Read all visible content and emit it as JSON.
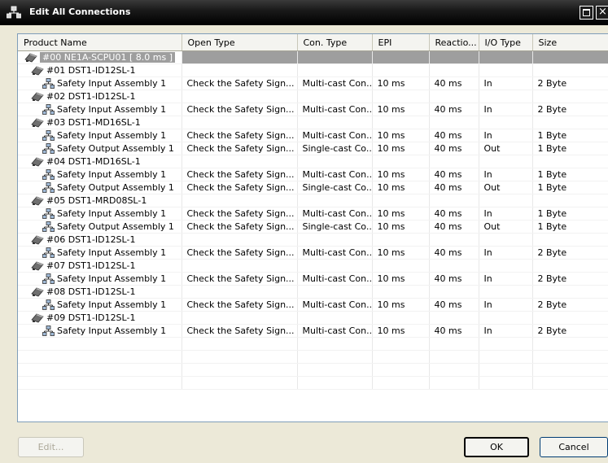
{
  "window": {
    "title": "Edit All Connections"
  },
  "columns": [
    "Product Name",
    "Open Type",
    "Con. Type",
    "EPI",
    "Reactio...",
    "I/O Type",
    "Size"
  ],
  "rows": [
    {
      "level": 0,
      "icon": "device",
      "cells": [
        "#00 NE1A-SCPU01 [ 8.0 ms ]",
        "",
        "",
        "",
        "",
        "",
        ""
      ]
    },
    {
      "level": 1,
      "icon": "device",
      "cells": [
        "#01 DST1-ID12SL-1",
        "",
        "",
        "",
        "",
        "",
        ""
      ]
    },
    {
      "level": 2,
      "icon": "connection",
      "cells": [
        "Safety Input Assembly 1",
        "Check the Safety Sign...",
        "Multi-cast Con...",
        "10 ms",
        "40 ms",
        "In",
        "2 Byte"
      ]
    },
    {
      "level": 1,
      "icon": "device",
      "cells": [
        "#02 DST1-ID12SL-1",
        "",
        "",
        "",
        "",
        "",
        ""
      ]
    },
    {
      "level": 2,
      "icon": "connection",
      "cells": [
        "Safety Input Assembly 1",
        "Check the Safety Sign...",
        "Multi-cast Con...",
        "10 ms",
        "40 ms",
        "In",
        "2 Byte"
      ]
    },
    {
      "level": 1,
      "icon": "device",
      "cells": [
        "#03 DST1-MD16SL-1",
        "",
        "",
        "",
        "",
        "",
        ""
      ]
    },
    {
      "level": 2,
      "icon": "connection",
      "cells": [
        "Safety Input Assembly 1",
        "Check the Safety Sign...",
        "Multi-cast Con...",
        "10 ms",
        "40 ms",
        "In",
        "1 Byte"
      ]
    },
    {
      "level": 2,
      "icon": "connection",
      "cells": [
        "Safety Output Assembly 1",
        "Check the Safety Sign...",
        "Single-cast Co...",
        "10 ms",
        "40 ms",
        "Out",
        "1 Byte"
      ]
    },
    {
      "level": 1,
      "icon": "device",
      "cells": [
        "#04 DST1-MD16SL-1",
        "",
        "",
        "",
        "",
        "",
        ""
      ]
    },
    {
      "level": 2,
      "icon": "connection",
      "cells": [
        "Safety Input Assembly 1",
        "Check the Safety Sign...",
        "Multi-cast Con...",
        "10 ms",
        "40 ms",
        "In",
        "1 Byte"
      ]
    },
    {
      "level": 2,
      "icon": "connection",
      "cells": [
        "Safety Output Assembly 1",
        "Check the Safety Sign...",
        "Single-cast Co...",
        "10 ms",
        "40 ms",
        "Out",
        "1 Byte"
      ]
    },
    {
      "level": 1,
      "icon": "device",
      "cells": [
        "#05 DST1-MRD08SL-1",
        "",
        "",
        "",
        "",
        "",
        ""
      ]
    },
    {
      "level": 2,
      "icon": "connection",
      "cells": [
        "Safety Input Assembly 1",
        "Check the Safety Sign...",
        "Multi-cast Con...",
        "10 ms",
        "40 ms",
        "In",
        "1 Byte"
      ]
    },
    {
      "level": 2,
      "icon": "connection",
      "cells": [
        "Safety Output Assembly 1",
        "Check the Safety Sign...",
        "Single-cast Co...",
        "10 ms",
        "40 ms",
        "Out",
        "1 Byte"
      ]
    },
    {
      "level": 1,
      "icon": "device",
      "cells": [
        "#06 DST1-ID12SL-1",
        "",
        "",
        "",
        "",
        "",
        ""
      ]
    },
    {
      "level": 2,
      "icon": "connection",
      "cells": [
        "Safety Input Assembly 1",
        "Check the Safety Sign...",
        "Multi-cast Con...",
        "10 ms",
        "40 ms",
        "In",
        "2 Byte"
      ]
    },
    {
      "level": 1,
      "icon": "device",
      "cells": [
        "#07 DST1-ID12SL-1",
        "",
        "",
        "",
        "",
        "",
        ""
      ]
    },
    {
      "level": 2,
      "icon": "connection",
      "cells": [
        "Safety Input Assembly 1",
        "Check the Safety Sign...",
        "Multi-cast Con...",
        "10 ms",
        "40 ms",
        "In",
        "2 Byte"
      ]
    },
    {
      "level": 1,
      "icon": "device",
      "cells": [
        "#08 DST1-ID12SL-1",
        "",
        "",
        "",
        "",
        "",
        ""
      ]
    },
    {
      "level": 2,
      "icon": "connection",
      "cells": [
        "Safety Input Assembly 1",
        "Check the Safety Sign...",
        "Multi-cast Con...",
        "10 ms",
        "40 ms",
        "In",
        "2 Byte"
      ]
    },
    {
      "level": 1,
      "icon": "device",
      "cells": [
        "#09 DST1-ID12SL-1",
        "",
        "",
        "",
        "",
        "",
        ""
      ]
    },
    {
      "level": 2,
      "icon": "connection",
      "cells": [
        "Safety Input Assembly 1",
        "Check the Safety Sign...",
        "Multi-cast Con...",
        "10 ms",
        "40 ms",
        "In",
        "2 Byte"
      ]
    }
  ],
  "buttons": {
    "edit": "Edit...",
    "ok": "OK",
    "cancel": "Cancel"
  },
  "colors": {
    "selected_row": "#9e9e9e",
    "list_border": "#7f9db9",
    "dialog_bg": "#ece9d8"
  }
}
